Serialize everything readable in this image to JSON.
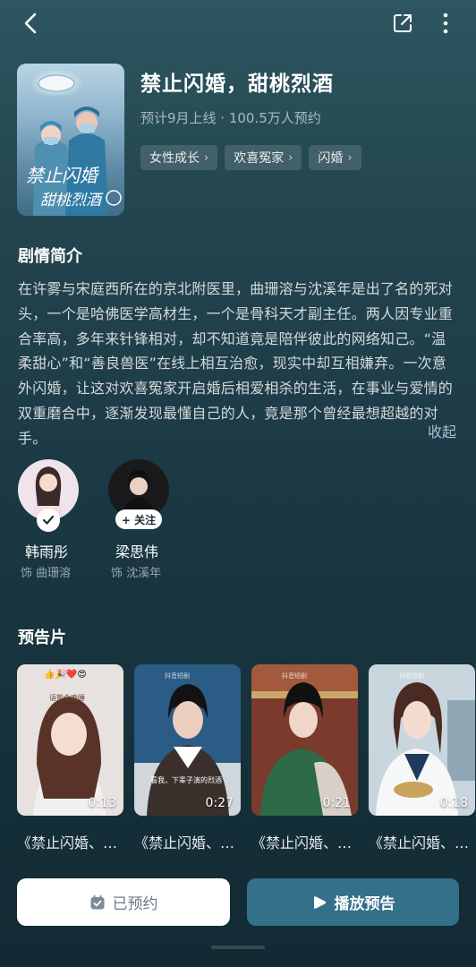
{
  "drama": {
    "title": "禁止闪婚，甜桃烈酒",
    "subtitle": "预计9月上线 · 100.5万人预约",
    "poster_text_line1": "禁止闪婚",
    "poster_text_line2": "甜桃烈酒",
    "tags": [
      "女性成长",
      "欢喜冤家",
      "闪婚"
    ]
  },
  "synopsis": {
    "heading": "剧情简介",
    "text": "在许雾与宋庭西所在的京北附医里，曲珊溶与沈溪年是出了名的死对头，一个是哈佛医学高材生，一个是骨科天才副主任。两人因专业重合率高，多年来针锋相对，却不知道竟是陪伴彼此的网络知己。“温柔甜心”和“善良兽医”在线上相互治愈，现实中却互相嫌弃。一次意外闪婚，让这对欢喜冤家开启婚后相爱相杀的生活，在事业与爱情的双重磨合中，逐渐发现最懂自己的人，竟是那个曾经最想超越的对手。",
    "collapse_label": "收起"
  },
  "cast": [
    {
      "name": "韩雨彤",
      "role": "饰 曲珊溶",
      "followed": true
    },
    {
      "name": "梁思伟",
      "role": "饰 沈溪年",
      "followed": false,
      "follow_label": "+ 关注"
    }
  ],
  "trailers": {
    "heading": "预告片",
    "items": [
      {
        "duration": "0:13",
        "title": "《禁止闪婚、…"
      },
      {
        "duration": "0:27",
        "title": "《禁止闪婚、…"
      },
      {
        "duration": "0:21",
        "title": "《禁止闪婚、…"
      },
      {
        "duration": "0:18",
        "title": "《禁止闪婚、…"
      }
    ],
    "thumb_overlay_text_1": "语熊今晚睡",
    "thumb_overlay_text_2": "看我，下辈子演的烈酒",
    "watermark": "抖音短剧"
  },
  "actions": {
    "reserved_label": "已预约",
    "play_trailer_label": "播放预告"
  },
  "colors": {
    "background_top": "#2d5660",
    "background_bottom": "#122a33",
    "primary_button": "#33708a",
    "link": "#b4d2e1"
  }
}
